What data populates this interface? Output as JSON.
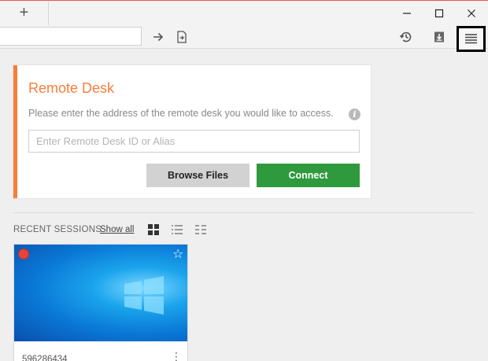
{
  "titlebar": {
    "new_tab_label": "+",
    "minimize_label": "–",
    "maximize_label": "☐",
    "close_label": "✕"
  },
  "toolbar": {
    "address_value": "",
    "go_icon": "arrow-right-icon",
    "file_transfer_icon": "file-arrow-icon",
    "history_icon": "history-icon",
    "download_icon": "download-icon",
    "menu_icon": "hamburger-icon"
  },
  "remote_desk": {
    "title": "Remote Desk",
    "description": "Please enter the address of the remote desk you would like to access.",
    "info_label": "i",
    "input_placeholder": "Enter Remote Desk ID or Alias",
    "input_value": "",
    "browse_label": "Browse Files",
    "connect_label": "Connect",
    "accent_color": "#f57f3b",
    "connect_color": "#2e9a3d"
  },
  "recent": {
    "label": "RECENT SESSIONS",
    "show_all_label": "Show all",
    "views": [
      "grid-view-icon",
      "list-view-icon",
      "compact-list-icon"
    ],
    "sessions": [
      {
        "id": "596286434",
        "status": "offline",
        "status_color": "#e8413a",
        "favorite": false
      }
    ]
  }
}
